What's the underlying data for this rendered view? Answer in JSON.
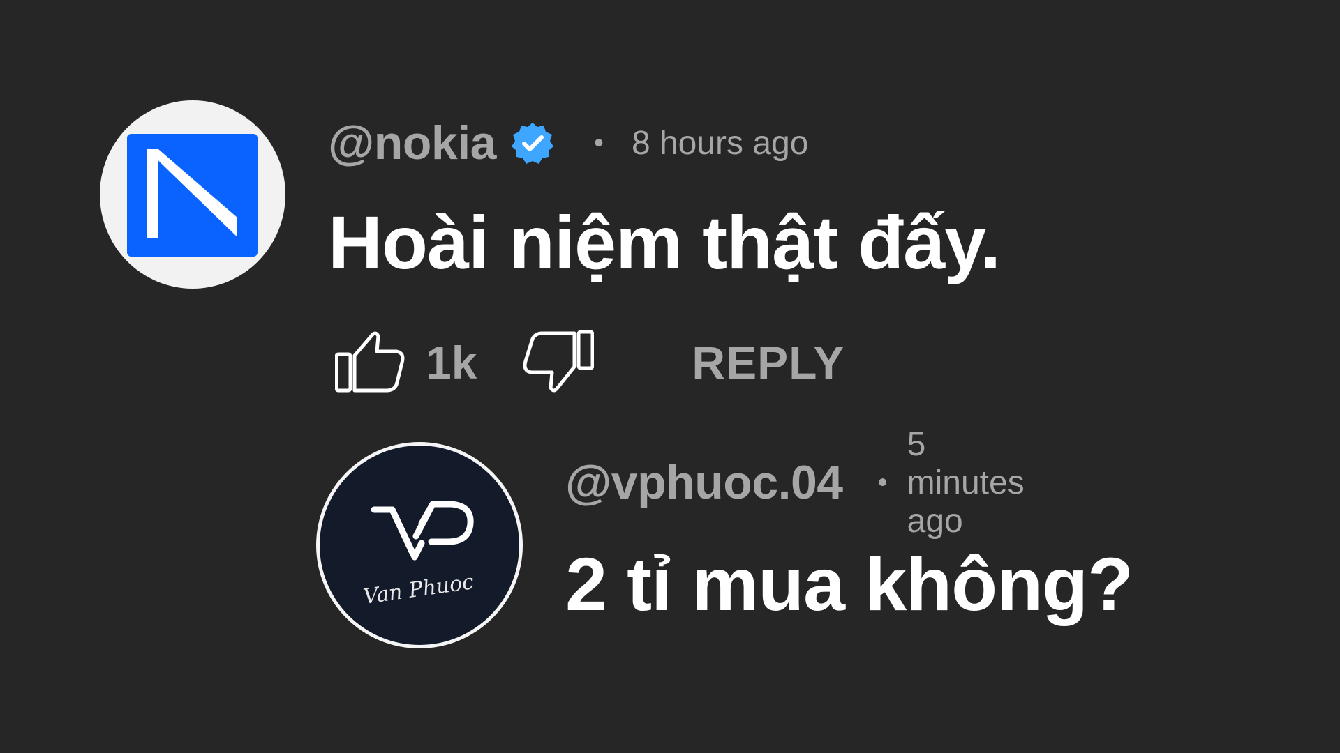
{
  "comments": [
    {
      "handle": "@nokia",
      "verified": true,
      "separator": "•",
      "time": "8 hours ago",
      "text": "Hoài niệm thật đấy.",
      "avatar": "nokia-logo",
      "likes": "1k",
      "reply_label": "REPLY"
    }
  ],
  "reply": {
    "handle": "@vphuoc.04",
    "separator": "•",
    "time": "5 minutes ago",
    "text": "2 tỉ mua không?",
    "avatar": "vp-logo",
    "avatar_script": "Van Phuoc"
  },
  "icons": {
    "verified": "verified-check-icon",
    "like": "thumbs-up-icon",
    "dislike": "thumbs-down-icon"
  },
  "colors": {
    "background": "#262626",
    "muted_text": "#a6a6a6",
    "body_text": "#ffffff",
    "verified_blue": "#3ea6ff",
    "nokia_blue": "#0a63ff",
    "vp_navy": "#131a2a"
  }
}
